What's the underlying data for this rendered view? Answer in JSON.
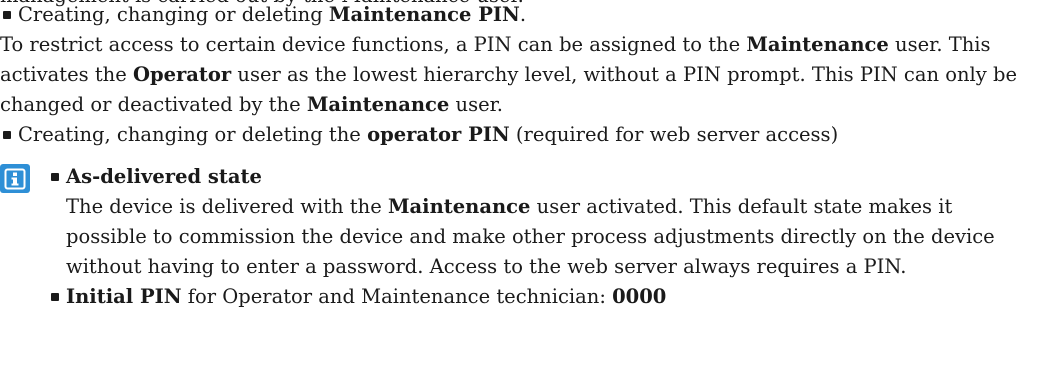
{
  "cut_line": "management is carried out by the Maintenance user.",
  "list": [
    {
      "lead": "Creating, changing or deleting ",
      "bold": "Maintenance PIN",
      "tail": ".",
      "para": {
        "t1": "To restrict access to certain device functions, a PIN can be assigned to the ",
        "b1": "Maintenance",
        "t2": " user. This activates the ",
        "b2": "Operator",
        "t3": " user as the lowest hierarchy level, without a PIN prompt. This PIN can only be changed or deactivated by the ",
        "b3": "Maintenance",
        "t4": " user."
      }
    },
    {
      "lead": "Creating, changing or deleting the ",
      "bold": "operator PIN",
      "tail": " (required for web server access)"
    }
  ],
  "note": {
    "icon": "info-icon",
    "icon_color": "#2e8fd6",
    "items": [
      {
        "heading": "As-delivered state",
        "t1": "The device is delivered with the ",
        "b1": "Maintenance",
        "t2": " user activated. This default state makes it possible to commission the device and make other process adjustments directly on the device without having to enter a password. Access to the web server always requires a PIN."
      },
      {
        "b1": "Initial PIN",
        "t1": " for Operator and Maintenance technician: ",
        "b2": "0000"
      }
    ]
  }
}
